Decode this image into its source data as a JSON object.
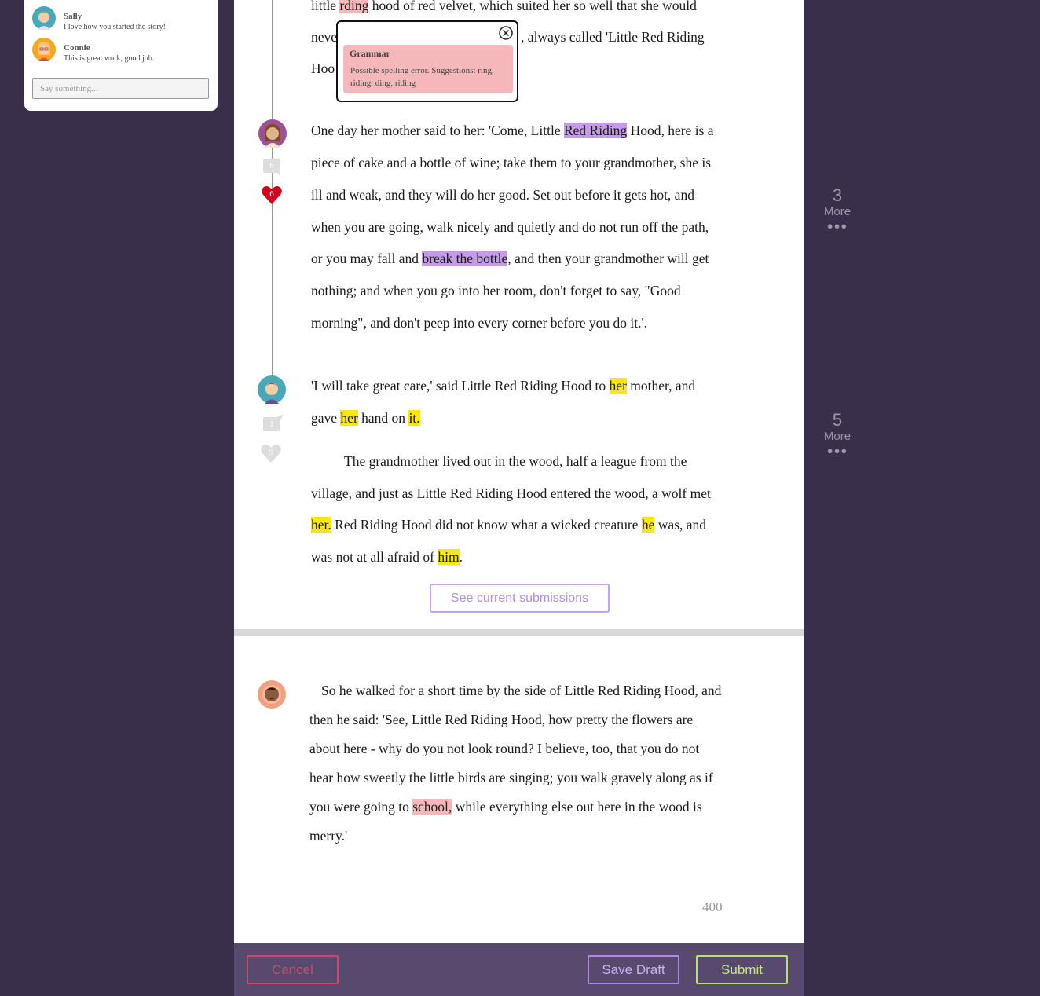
{
  "comments": [
    {
      "name": "Sally",
      "text": "I love how you started the story!"
    },
    {
      "name": "Connie",
      "text": "This is great work, good job."
    }
  ],
  "comment_input": {
    "placeholder": "Say something..."
  },
  "story": {
    "p1": {
      "l1": [
        "little ",
        "rding",
        " hood of red velvet, which suited her so well that she would"
      ],
      "l2": [
        "neve",
        ", always called 'Little Red Riding"
      ],
      "l3": [
        "Hoo"
      ]
    },
    "p2": {
      "l1": [
        "One day her mother said to her: 'Come, Little ",
        "Red Riding",
        " Hood, here is a"
      ],
      "l2": "piece of cake and a bottle of wine; take them to your grandmother, she is",
      "l3": "ill and weak, and they will do her good. Set out before it gets hot, and",
      "l4": "when you are going, walk nicely and quietly and do not run off the path,",
      "l5": [
        "or you may fall and ",
        "break the bottle",
        ", and then your grandmother will get"
      ],
      "l6": "nothing; and when you go into her room, don't forget to say, \"Good",
      "l7": "morning\", and don't peep into every corner before you do it.'."
    },
    "p3": {
      "l1": [
        " 'I will take great care,' said Little Red Riding Hood to ",
        "her",
        " mother, and"
      ],
      "l2": [
        "gave ",
        "her",
        " hand on ",
        "it."
      ]
    },
    "p4": {
      "l1": "The grandmother lived out in the wood, half a league from the",
      "l2": "village, and just as Little Red Riding Hood entered the wood, a wolf met",
      "l3": [
        "her.",
        " Red Riding Hood did not know what a wicked creature ",
        "he",
        " was, and"
      ],
      "l4": [
        "was not at all afraid of ",
        "him",
        "."
      ]
    },
    "p5": {
      "l1": "So he walked for a short time by the side of Little Red Riding Hood, and",
      "l2": "then he said: 'See, Little Red Riding Hood, how pretty the flowers are",
      "l3": "about here - why do you not look round? I believe, too, that you do not",
      "l4": "hear how sweetly the little birds are singing; you walk gravely along as if",
      "l5": [
        "you were going to ",
        "school,",
        " while everything else out here in the wood is"
      ],
      "l6": "merry.'"
    }
  },
  "popup": {
    "title": "Grammar",
    "message": "Possible spelling error.  Suggestions: ring, riding, ding, riding"
  },
  "markers": {
    "p2": {
      "comments": "6",
      "likes": "6"
    },
    "p3": {
      "comments": "1",
      "likes": "9"
    }
  },
  "see_submissions_label": "See current submissions",
  "word_count": "400",
  "more_indicators": [
    {
      "count": "3",
      "label": "More"
    },
    {
      "count": "5",
      "label": "More"
    }
  ],
  "actions": {
    "cancel": "Cancel",
    "save_draft": "Save Draft",
    "submit": "Submit"
  },
  "colors": {
    "background": "#392f4b",
    "bottom_bar": "#574a6e",
    "spelling_highlight": "#f6b7bb",
    "phrase_highlight": "#c39be6",
    "pronoun_highlight": "#f6e815",
    "cancel": "#d9426d",
    "save_draft": "#a98be6",
    "submit": "#b8e070",
    "like_heart": "#d0021b"
  }
}
